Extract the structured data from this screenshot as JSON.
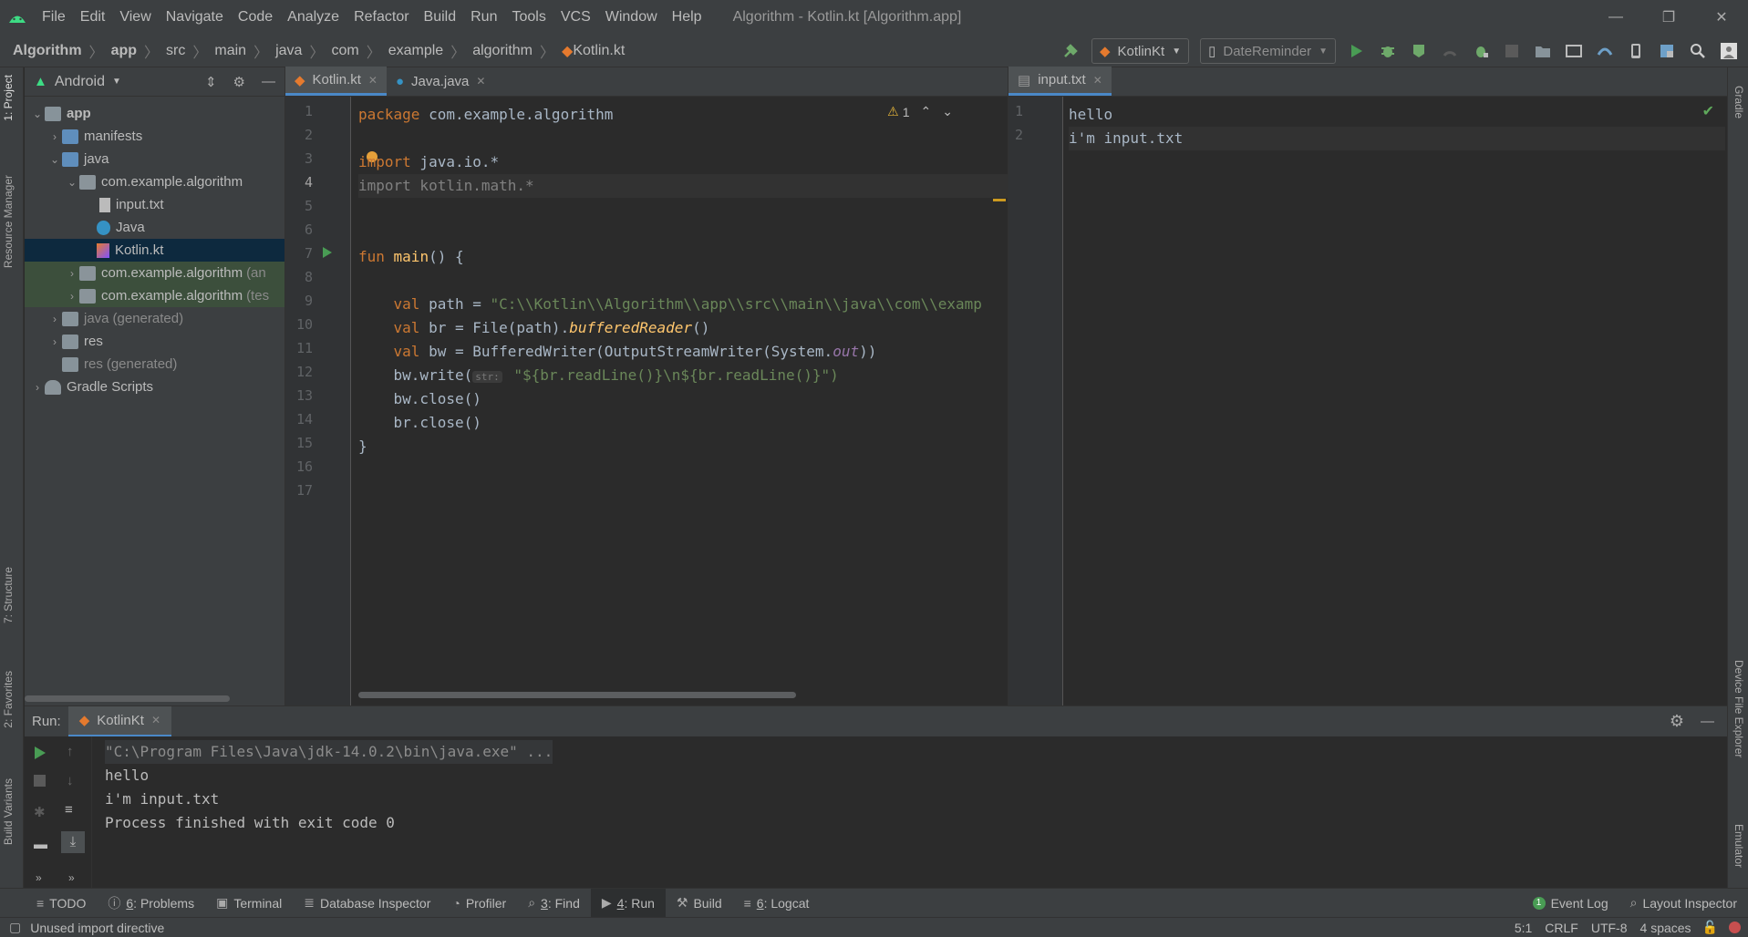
{
  "menu": [
    "File",
    "Edit",
    "View",
    "Navigate",
    "Code",
    "Analyze",
    "Refactor",
    "Build",
    "Run",
    "Tools",
    "VCS",
    "Window",
    "Help"
  ],
  "window_title": "Algorithm - Kotlin.kt [Algorithm.app]",
  "breadcrumb": [
    "Algorithm",
    "app",
    "src",
    "main",
    "java",
    "com",
    "example",
    "algorithm",
    "Kotlin.kt"
  ],
  "run_config": "KotlinKt",
  "device": "DateReminder",
  "project_view": "Android",
  "tree": [
    {
      "label": "app",
      "indent": 0,
      "arrow": "down",
      "icon": "folder",
      "cls": "",
      "extra": ""
    },
    {
      "label": "manifests",
      "indent": 1,
      "arrow": "right",
      "icon": "folder-blue",
      "cls": "",
      "extra": ""
    },
    {
      "label": "java",
      "indent": 1,
      "arrow": "down",
      "icon": "folder-blue",
      "cls": "",
      "extra": ""
    },
    {
      "label": "com.example.algorithm",
      "indent": 2,
      "arrow": "down",
      "icon": "package",
      "cls": "",
      "extra": ""
    },
    {
      "label": "input.txt",
      "indent": 3,
      "arrow": "",
      "icon": "file",
      "cls": "",
      "extra": ""
    },
    {
      "label": "Java",
      "indent": 3,
      "arrow": "",
      "icon": "java",
      "cls": "",
      "extra": ""
    },
    {
      "label": "Kotlin.kt",
      "indent": 3,
      "arrow": "",
      "icon": "kotlin",
      "cls": "sel",
      "extra": ""
    },
    {
      "label": "com.example.algorithm",
      "indent": 2,
      "arrow": "right",
      "icon": "package",
      "cls": "green",
      "extra": "(an"
    },
    {
      "label": "com.example.algorithm",
      "indent": 2,
      "arrow": "right",
      "icon": "package",
      "cls": "green",
      "extra": "(tes"
    },
    {
      "label": "java",
      "indent": 1,
      "arrow": "right",
      "icon": "folder",
      "cls": "gray",
      "extra": "(generated)"
    },
    {
      "label": "res",
      "indent": 1,
      "arrow": "right",
      "icon": "folder",
      "cls": "",
      "extra": ""
    },
    {
      "label": "res",
      "indent": 1,
      "arrow": "",
      "icon": "folder",
      "cls": "gray",
      "extra": "(generated)"
    },
    {
      "label": "Gradle Scripts",
      "indent": 0,
      "arrow": "right",
      "icon": "gradle",
      "cls": "",
      "extra": ""
    }
  ],
  "editor_tabs": [
    {
      "label": "Kotlin.kt",
      "active": true
    },
    {
      "label": "Java.java",
      "active": false
    }
  ],
  "warning_count": "1",
  "code_lines": [
    "1",
    "2",
    "3",
    "4",
    "5",
    "6",
    "7",
    "8",
    "9",
    "10",
    "11",
    "12",
    "13",
    "14",
    "15",
    "16",
    "17"
  ],
  "code": {
    "l1a": "package",
    "l1b": " com.example.algorithm",
    "l3a": "import",
    "l3b": " java.io.*",
    "l4": "import kotlin.math.*",
    "l7a": "fun",
    "l7b": " main",
    "l7c": "() {",
    "l9a": "    val",
    "l9b": " path = ",
    "l9c": "\"C:\\\\Kotlin\\\\Algorithm\\\\app\\\\src\\\\main\\\\java\\\\com\\\\examp",
    "l10a": "    val",
    "l10b": " br = File(path).",
    "l10c": "bufferedReader",
    "l10d": "()",
    "l11a": "    val",
    "l11b": " bw = BufferedWriter(OutputStreamWriter(System.",
    "l11c": "out",
    "l11d": "))",
    "l12a": "    bw.write(",
    "l12hint": "str:",
    "l12b": " \"${br.readLine()}\\n${br.readLine()}\")",
    "l13": "    bw.close()",
    "l14": "    br.close()",
    "l15": "}"
  },
  "right_tab": "input.txt",
  "right_lines": [
    "1",
    "2"
  ],
  "right_text": [
    "hello",
    "i'm input.txt"
  ],
  "run_label": "Run:",
  "run_tab": "KotlinKt",
  "console": [
    "\"C:\\Program Files\\Java\\jdk-14.0.2\\bin\\java.exe\" ...",
    "hello",
    "i'm input.txt",
    "Process finished with exit code 0"
  ],
  "left_vtabs": [
    "1: Project",
    "Resource Manager",
    "7: Structure",
    "2: Favorites",
    "Build Variants"
  ],
  "right_vtabs": [
    "Gradle",
    "Device File Explorer",
    "Emulator"
  ],
  "tool_windows": [
    {
      "num": "",
      "label": "TODO"
    },
    {
      "num": "6",
      "label": ": Problems"
    },
    {
      "num": "",
      "label": "Terminal"
    },
    {
      "num": "",
      "label": "Database Inspector"
    },
    {
      "num": "",
      "label": "Profiler"
    },
    {
      "num": "3",
      "label": ": Find"
    },
    {
      "num": "4",
      "label": ": Run"
    },
    {
      "num": "",
      "label": "Build"
    },
    {
      "num": "6",
      "label": ": Logcat"
    }
  ],
  "event_log": "Event Log",
  "layout_inspector": "Layout Inspector",
  "status_msg": "Unused import directive",
  "status_right": [
    "5:1",
    "CRLF",
    "UTF-8",
    "4 spaces"
  ],
  "colors": {
    "bg": "#2b2b2b",
    "panel": "#3c3f41",
    "accent": "#4a88c7",
    "run_green": "#499c54"
  }
}
